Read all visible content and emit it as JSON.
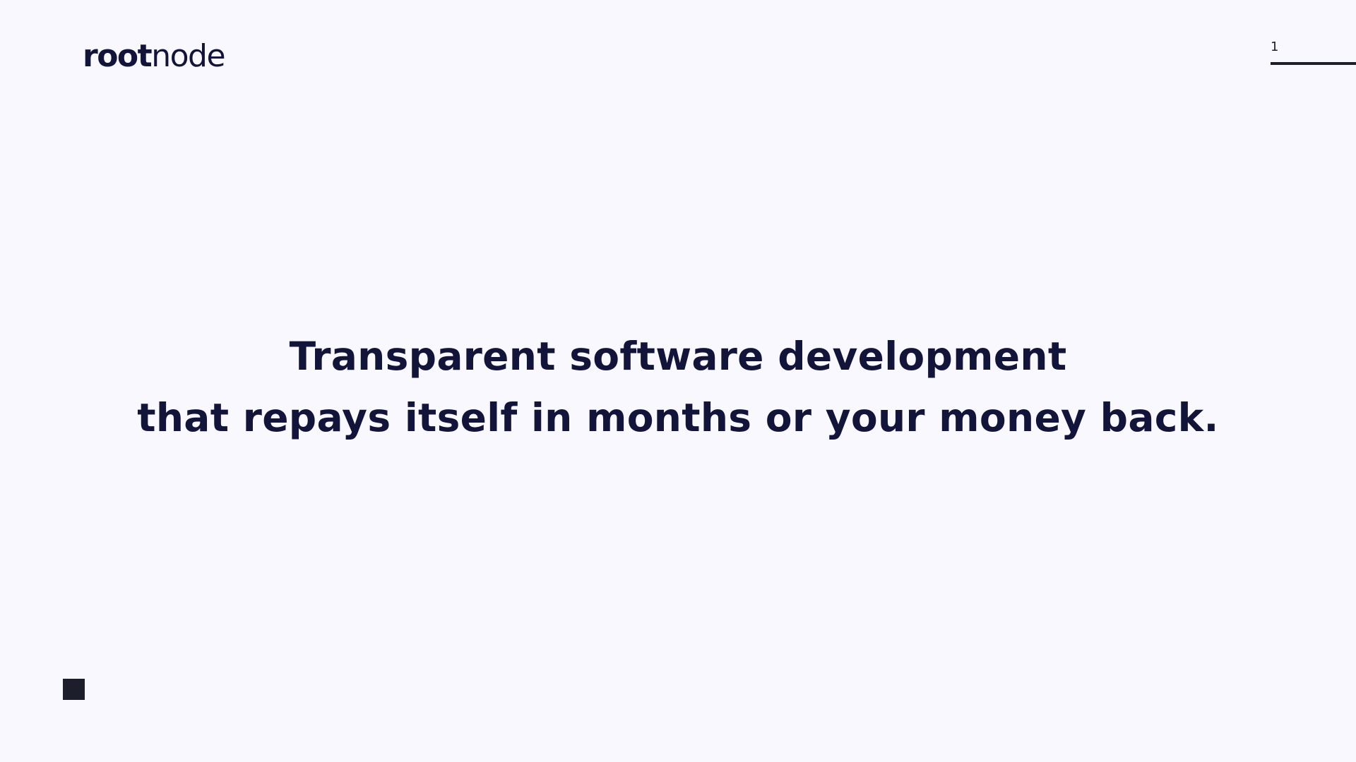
{
  "brand": {
    "logo_bold": "root",
    "logo_light": "node"
  },
  "pager": {
    "current_page": "1"
  },
  "slide": {
    "headline_line1": "Transparent software development",
    "headline_line2": "that repays itself in months or your money back."
  },
  "colors": {
    "background": "#f8f8fe",
    "text": "#12143a",
    "accent_dark": "#1d1e2b"
  }
}
